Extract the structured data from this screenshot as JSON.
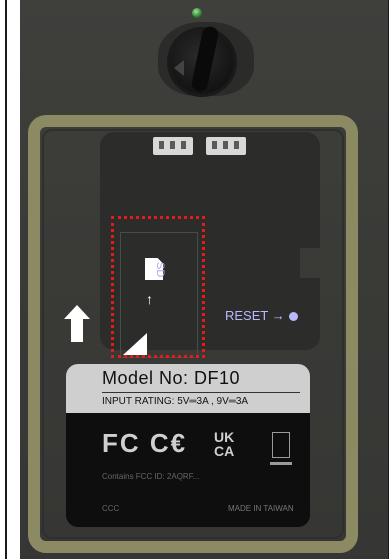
{
  "label": {
    "model_text": "Model  No:  DF10",
    "rating_text": "INPUT  RATING:  5V═3A , 9V═3A",
    "marks_text": "FC C€",
    "ukca_line1": "UK",
    "ukca_line2": "CA",
    "fine_print": "Contains  FCC  ID:  2AQRF...",
    "left_small": "CCC",
    "made_in": "MADE  IN  TAIWAN"
  },
  "panel": {
    "sd_label": "SD",
    "reset_label": "RESET →"
  },
  "icons": {
    "led": "led-indicator-icon",
    "knob": "rotary-knob-icon",
    "sd_card": "sd-card-icon",
    "arrow_up": "arrow-up-icon",
    "weee": "weee-bin-icon"
  },
  "colors": {
    "device_body": "#3a3a37",
    "bracket": "#8c8a63",
    "sd_highlight": "#e21b1b",
    "label_text_blue": "#b9b9ff",
    "led": "#2e7d32"
  }
}
